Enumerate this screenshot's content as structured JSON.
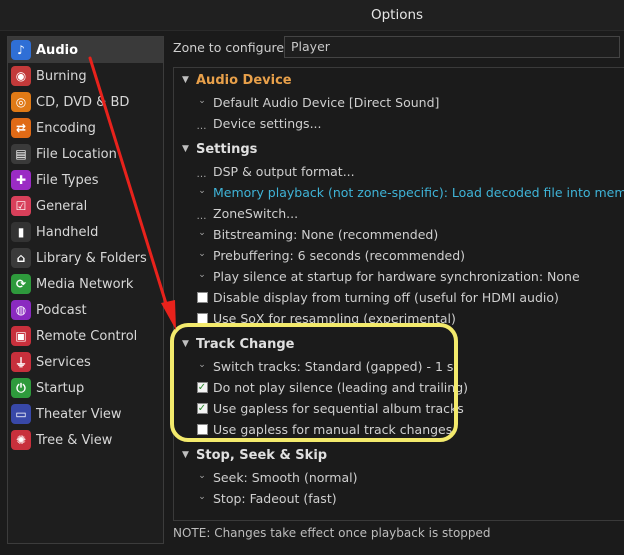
{
  "window": {
    "title": "Options"
  },
  "sidebar": {
    "items": [
      {
        "label": "Audio",
        "icon": "music-note-icon",
        "color": "#2f6fd6",
        "glyph": "♪"
      },
      {
        "label": "Burning",
        "icon": "disc-burn-icon",
        "color": "#c33a3a",
        "glyph": "◉"
      },
      {
        "label": "CD, DVD & BD",
        "icon": "disc-icon",
        "color": "#e07a16",
        "glyph": "◎"
      },
      {
        "label": "Encoding",
        "icon": "encoding-icon",
        "color": "#e06a16",
        "glyph": "⇄"
      },
      {
        "label": "File Location",
        "icon": "file-location-icon",
        "color": "#3a3a3a",
        "glyph": "▤"
      },
      {
        "label": "File Types",
        "icon": "puzzle-icon",
        "color": "#9b2bc4",
        "glyph": "✚"
      },
      {
        "label": "General",
        "icon": "checklist-icon",
        "color": "#d8405a",
        "glyph": "☑"
      },
      {
        "label": "Handheld",
        "icon": "handheld-icon",
        "color": "#333333",
        "glyph": "▮"
      },
      {
        "label": "Library & Folders",
        "icon": "library-icon",
        "color": "#3a3a3a",
        "glyph": "⌂"
      },
      {
        "label": "Media Network",
        "icon": "network-icon",
        "color": "#2e9a3c",
        "glyph": "⟳"
      },
      {
        "label": "Podcast",
        "icon": "podcast-icon",
        "color": "#8a2ac0",
        "glyph": "◍"
      },
      {
        "label": "Remote Control",
        "icon": "remote-icon",
        "color": "#c8303c",
        "glyph": "▣"
      },
      {
        "label": "Services",
        "icon": "plug-icon",
        "color": "#c8303c",
        "glyph": "⏚"
      },
      {
        "label": "Startup",
        "icon": "power-icon",
        "color": "#2e9a3c",
        "glyph": "⏻"
      },
      {
        "label": "Theater View",
        "icon": "monitor-icon",
        "color": "#3848a8",
        "glyph": "▭"
      },
      {
        "label": "Tree & View",
        "icon": "gear-icon",
        "color": "#c8303c",
        "glyph": "✺"
      }
    ]
  },
  "zone": {
    "label": "Zone to configure:",
    "value": "Player"
  },
  "tree": {
    "audio_device": {
      "title": "Audio Device",
      "items": [
        "Default Audio Device [Direct Sound]",
        "Device settings..."
      ]
    },
    "settings": {
      "title": "Settings",
      "items": [
        "DSP & output format...",
        "Memory playback (not zone-specific): Load decoded file into memory",
        "ZoneSwitch...",
        "Bitstreaming: None (recommended)",
        "Prebuffering: 6 seconds (recommended)",
        "Play silence at startup for hardware synchronization: None",
        "Disable display from turning off (useful for HDMI audio)",
        "Use SoX for resampling (experimental)"
      ]
    },
    "track_change": {
      "title": "Track Change",
      "items": [
        "Switch tracks: Standard (gapped) - 1 s",
        "Do not play silence (leading and trailing)",
        "Use gapless for sequential album tracks",
        "Use gapless for manual track changes"
      ]
    },
    "stop_seek_skip": {
      "title": "Stop, Seek & Skip",
      "items": [
        "Seek: Smooth (normal)",
        "Stop: Fadeout (fast)"
      ]
    }
  },
  "footer": {
    "note": "NOTE: Changes take effect once playback is stopped"
  },
  "colors": {
    "accent_orange": "#e8a04a",
    "link_blue": "#3fb4d8",
    "highlight_yellow": "#f3ea6c",
    "arrow_red": "#e8221c"
  }
}
